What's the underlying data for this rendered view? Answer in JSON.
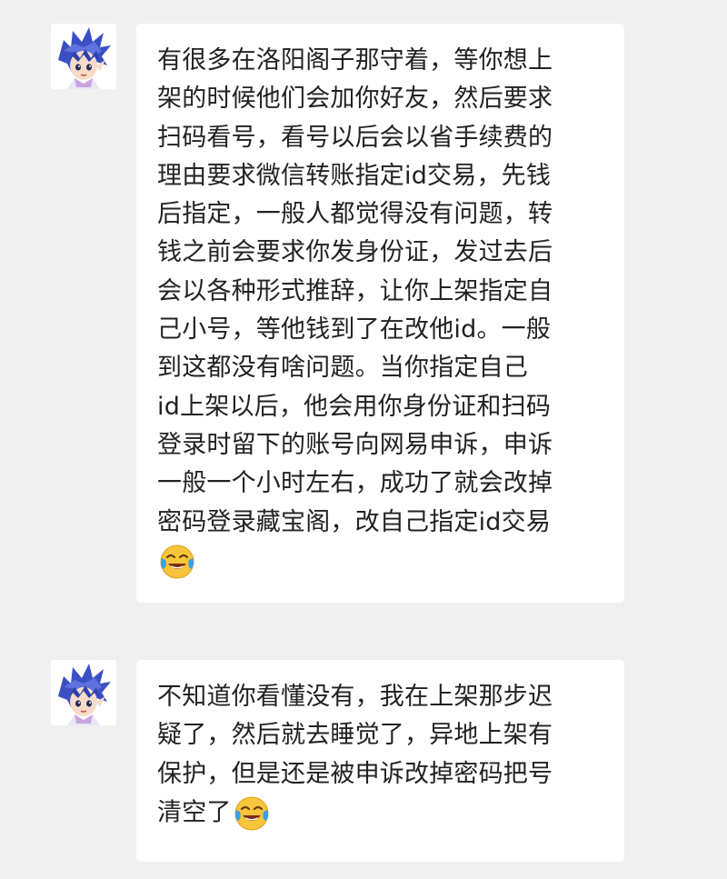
{
  "messages": [
    {
      "avatar_icon": "spiky-blue-hair-character-avatar",
      "lines": [
        "有很多在洛阳阁子那守着，等你想上",
        "架的时候他们会加你好友，然后要求",
        "扫码看号，看号以后会以省手续费的",
        "理由要求微信转账指定id交易，先钱",
        "后指定，一般人都觉得没有问题，转",
        "钱之前会要求你发身份证，发过去后",
        "会以各种形式推辞，让你上架指定自",
        "己小号，等他钱到了在改他id。一般",
        "到这都没有啥问题。当你指定自己",
        "id上架以后，他会用你身份证和扫码",
        "登录时留下的账号向网易申诉，申诉",
        "一般一个小时左右，成功了就会改掉",
        "密码登录藏宝阁，改自己指定id交易"
      ],
      "trailing": "",
      "trailing_emoji": "crying-laughing-emoji"
    },
    {
      "avatar_icon": "spiky-blue-hair-character-avatar",
      "lines": [
        "不知道你看懂没有，我在上架那步迟",
        "疑了，然后就去睡觉了，异地上架有",
        "保护，但是还是被申诉改掉密码把号"
      ],
      "trailing": "清空了",
      "trailing_emoji": "crying-laughing-emoji"
    }
  ],
  "colors": {
    "background": "#f0f0f0",
    "bubble": "#ffffff",
    "text": "#222222",
    "emoji_face": "#f7c53b",
    "emoji_tears": "#3aa0e8",
    "avatar_hair": "#3b4fc4"
  }
}
